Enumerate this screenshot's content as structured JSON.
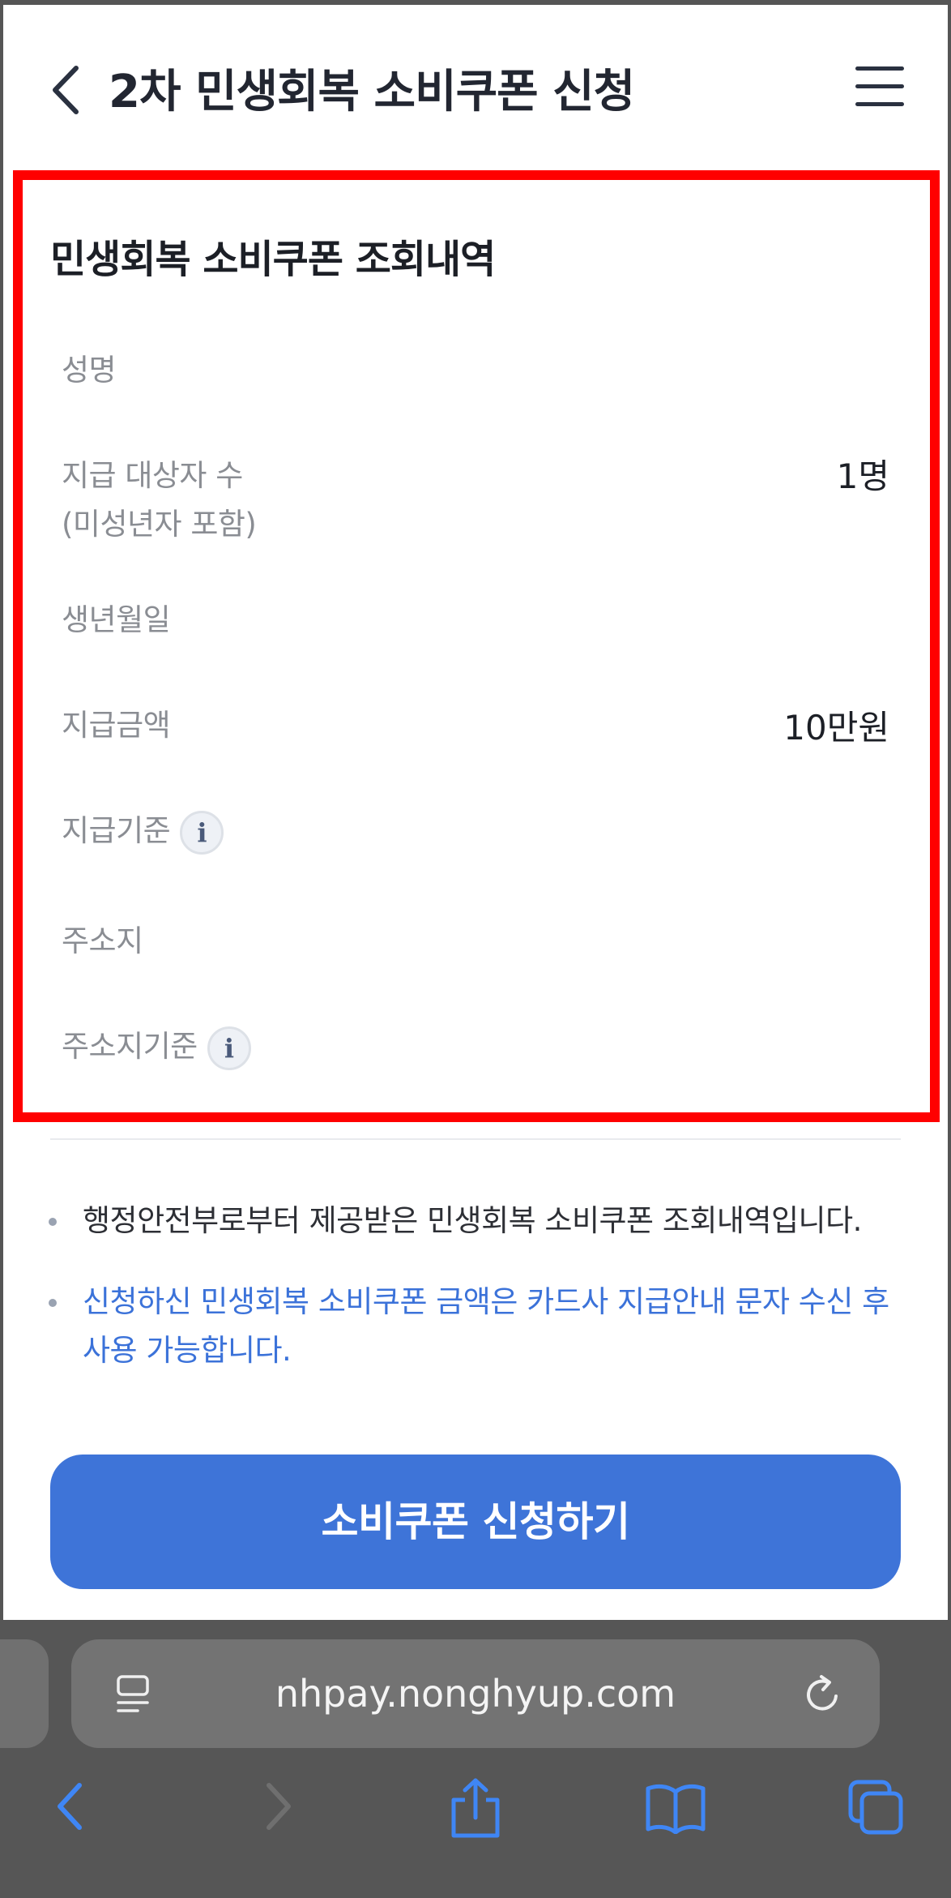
{
  "header": {
    "title": "2차 민생회복 소비쿠폰 신청"
  },
  "card": {
    "title": "민생회복 소비쿠폰 조회내역",
    "rows": [
      {
        "label": "성명",
        "value": ""
      },
      {
        "label": "지급 대상자 수",
        "label2": "(미성년자 포함)",
        "value": "1명"
      },
      {
        "label": "생년월일",
        "value": ""
      },
      {
        "label": "지급금액",
        "value": "10만원"
      },
      {
        "label": "지급기준",
        "value": ""
      },
      {
        "label": "주소지",
        "value": ""
      },
      {
        "label": "주소지기준",
        "value": ""
      }
    ],
    "info_glyph": "i"
  },
  "notes": [
    "행정안전부로부터 제공받은 민생회복 소비쿠폰 조회내역입니다.",
    "신청하신 민생회복 소비쿠폰 금액은 카드사 지급안내 문자 수신 후 사용 가능합니다."
  ],
  "apply_button": "소비쿠폰 신청하기",
  "browser": {
    "url": "nhpay.nonghyup.com"
  },
  "colors": {
    "accent": "#3e74d8",
    "highlight": "#ff0000",
    "note_blue": "#3b72d9"
  },
  "icons": [
    "chevron-left-icon",
    "hamburger-menu-icon",
    "info-icon",
    "reader-icon",
    "reload-icon",
    "back-icon",
    "forward-icon",
    "share-icon",
    "bookmarks-icon",
    "tabs-icon"
  ]
}
